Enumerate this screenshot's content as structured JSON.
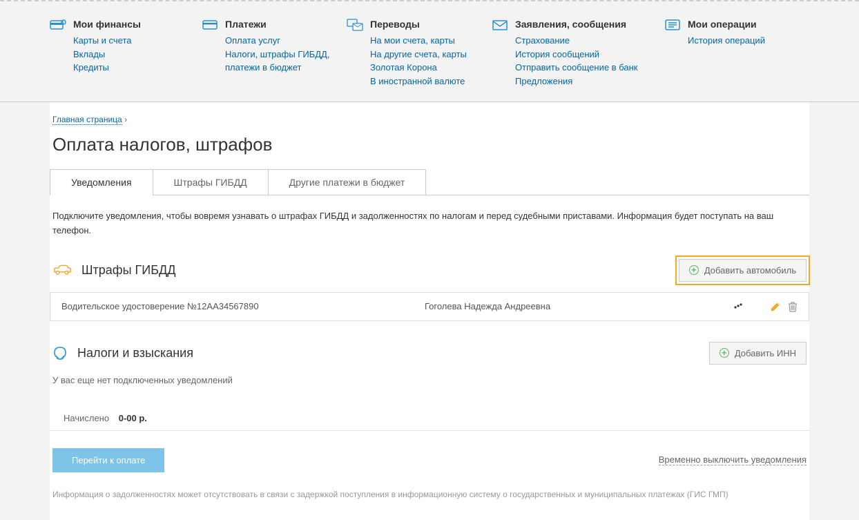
{
  "nav": [
    {
      "title": "Мои финансы",
      "links": [
        "Карты и счета",
        "Вклады",
        "Кредиты"
      ]
    },
    {
      "title": "Платежи",
      "links": [
        "Оплата услуг",
        "Налоги, штрафы ГИБДД, платежи в бюджет"
      ]
    },
    {
      "title": "Переводы",
      "links": [
        "На мои счета, карты",
        "На другие счета, карты",
        "Золотая Корона",
        "В иностранной валюте"
      ]
    },
    {
      "title": "Заявления, сообщения",
      "links": [
        "Страхование",
        "История сообщений",
        "Отправить сообщение в банк",
        "Предложения"
      ]
    },
    {
      "title": "Мои операции",
      "links": [
        "История операций"
      ]
    }
  ],
  "breadcrumb": {
    "home": "Главная страница",
    "sep": "›"
  },
  "page_title": "Оплата налогов, штрафов",
  "tabs": [
    "Уведомления",
    "Штрафы ГИБДД",
    "Другие платежи в бюджет"
  ],
  "info_text": "Подключите уведомления, чтобы вовремя узнавать о штрафах ГИБДД и задолженностях по налогам и перед судебными приставами. Информация будет поступать на ваш телефон.",
  "fines": {
    "title": "Штрафы ГИБДД",
    "add_btn": "Добавить автомобиль",
    "record": {
      "doc": "Водительское удостоверение №12АА34567890",
      "name": "Гоголева Надежда Андреевна"
    }
  },
  "taxes": {
    "title": "Налоги и взыскания",
    "add_btn": "Добавить ИНН",
    "no_notif": "У вас еще нет подключенных уведомлений"
  },
  "accrued": {
    "label": "Начислено",
    "value": "0-00 р."
  },
  "pay_btn": "Перейти к оплате",
  "disable_link": "Временно выключить уведомления",
  "disclaimer": "Информация о задолженностях может отсутствовать в связи с задержкой поступления в информационную систему о государственных и муниципальных платежах (ГИС ГМП)"
}
